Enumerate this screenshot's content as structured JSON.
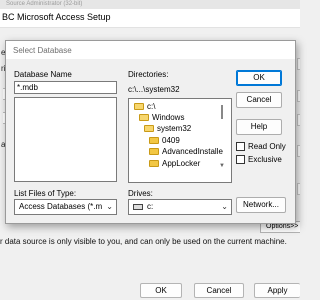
{
  "background_window": {
    "top_strip_text": "Source Administrator (32-bit)",
    "title": "BC Microsoft Access Setup",
    "fragments": [
      "e S",
      "rip",
      "ase"
    ],
    "note": "r data source is only visible to you, and can only be used on the current machine.",
    "options_button": "Options>>",
    "ok_label": "OK",
    "cancel_label": "Cancel",
    "apply_label": "Apply"
  },
  "dialog": {
    "title": "Select Database",
    "database_name_label": "Database Name",
    "database_name_value": "*.mdb",
    "directories_label": "Directories:",
    "current_path": "c:\\...\\system32",
    "directories": [
      {
        "name": "c:\\",
        "open": true
      },
      {
        "name": "Windows",
        "open": true
      },
      {
        "name": "system32",
        "open": true,
        "selected": true
      },
      {
        "name": "0409",
        "open": false
      },
      {
        "name": "AdvancedInstalle",
        "open": false
      },
      {
        "name": "AppLocker",
        "open": false
      }
    ],
    "list_files_label": "List Files of Type:",
    "file_type_value": "Access Databases (*.m",
    "drives_label": "Drives:",
    "drive_value": "c:",
    "buttons": {
      "ok": "OK",
      "cancel": "Cancel",
      "help": "Help",
      "network": "Network..."
    },
    "read_only_label": "Read Only",
    "exclusive_label": "Exclusive"
  }
}
